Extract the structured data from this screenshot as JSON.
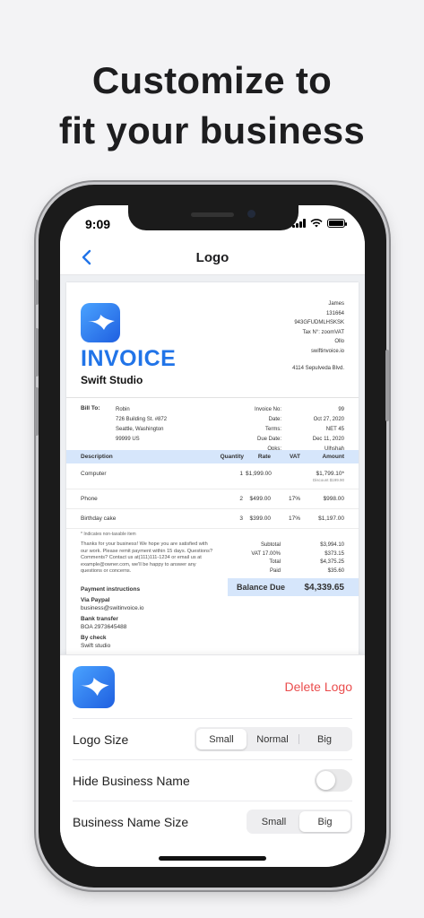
{
  "headline": {
    "line1": "Customize to",
    "line2": "fit your business"
  },
  "status": {
    "time": "9:09"
  },
  "nav": {
    "title": "Logo"
  },
  "invoice": {
    "title": "INVOICE",
    "business": "Swift  Studio",
    "from": [
      "James",
      "131664",
      "943GFUDMLHSKSK",
      "Tax N°: zoomVAT",
      "Ollo",
      "swiftinvoice.io",
      "4114 Sepulveda Blvd."
    ],
    "bill_to_label": "Bill To:",
    "bill_to": [
      "Robin",
      "726 Building St. #872",
      "Seattle, Washington",
      "99999 US"
    ],
    "meta_labels": [
      "Invoice No:",
      "Date:",
      "Terms:",
      "Due Date:",
      "Opks:"
    ],
    "meta_values": [
      "99",
      "Oct 27, 2020",
      "NET 45",
      "Dec 11, 2020",
      "Ulhshah"
    ],
    "columns": {
      "desc": "Description",
      "qty": "Quantity",
      "rate": "Rate",
      "vat": "VAT",
      "amount": "Amount"
    },
    "items": [
      {
        "desc": "Computer",
        "qty": "1",
        "rate": "$1,999.00",
        "vat": "",
        "amount": "$1,799.10*",
        "discount": "Discount $199.90"
      },
      {
        "desc": "Phone",
        "qty": "2",
        "rate": "$499.00",
        "vat": "17%",
        "amount": "$998.00",
        "discount": ""
      },
      {
        "desc": "Birthday cake",
        "qty": "3",
        "rate": "$399.00",
        "vat": "17%",
        "amount": "$1,197.00",
        "discount": ""
      }
    ],
    "nontax_note": "* Indicates non-taxable item",
    "thanks": "Thanks for your business! We hope you are satisfied with our work. Please remit payment within 15 days. Questions? Comments? Contact us at(111)111-1234 or email us at example@owner.com, we'll be happy to answer any questions or concerns.",
    "total_labels": [
      "Subtotal",
      "VAT 17.00%",
      "Total",
      "Paid"
    ],
    "total_values": [
      "$3,994.10",
      "$373.15",
      "$4,375.25",
      "$35.60"
    ],
    "balance_label": "Balance Due",
    "balance_value": "$4,339.65",
    "payment_title": "Payment instructions",
    "paypal_title": "Via Paypal",
    "paypal_value": "business@switinvoice.io",
    "bank_title": "Bank transfer",
    "bank_value": "BOA 2973645488",
    "check_title": "By check",
    "check_value": "Swift studio"
  },
  "sheet": {
    "delete_logo": "Delete Logo",
    "logo_size": {
      "label": "Logo Size",
      "options": [
        "Small",
        "Normal",
        "Big"
      ],
      "selected": "Small"
    },
    "hide_name": {
      "label": "Hide Business Name",
      "on": false
    },
    "name_size": {
      "label": "Business Name Size",
      "options": [
        "Small",
        "Big"
      ],
      "selected": "Big"
    }
  },
  "colors": {
    "accent": "#2174e8",
    "danger": "#ea4d4d",
    "table_header": "#d6e6fb"
  },
  "icons": [
    "back-chevron-icon",
    "swift-bird-logo-icon",
    "signal-icon",
    "wifi-icon",
    "battery-icon"
  ]
}
